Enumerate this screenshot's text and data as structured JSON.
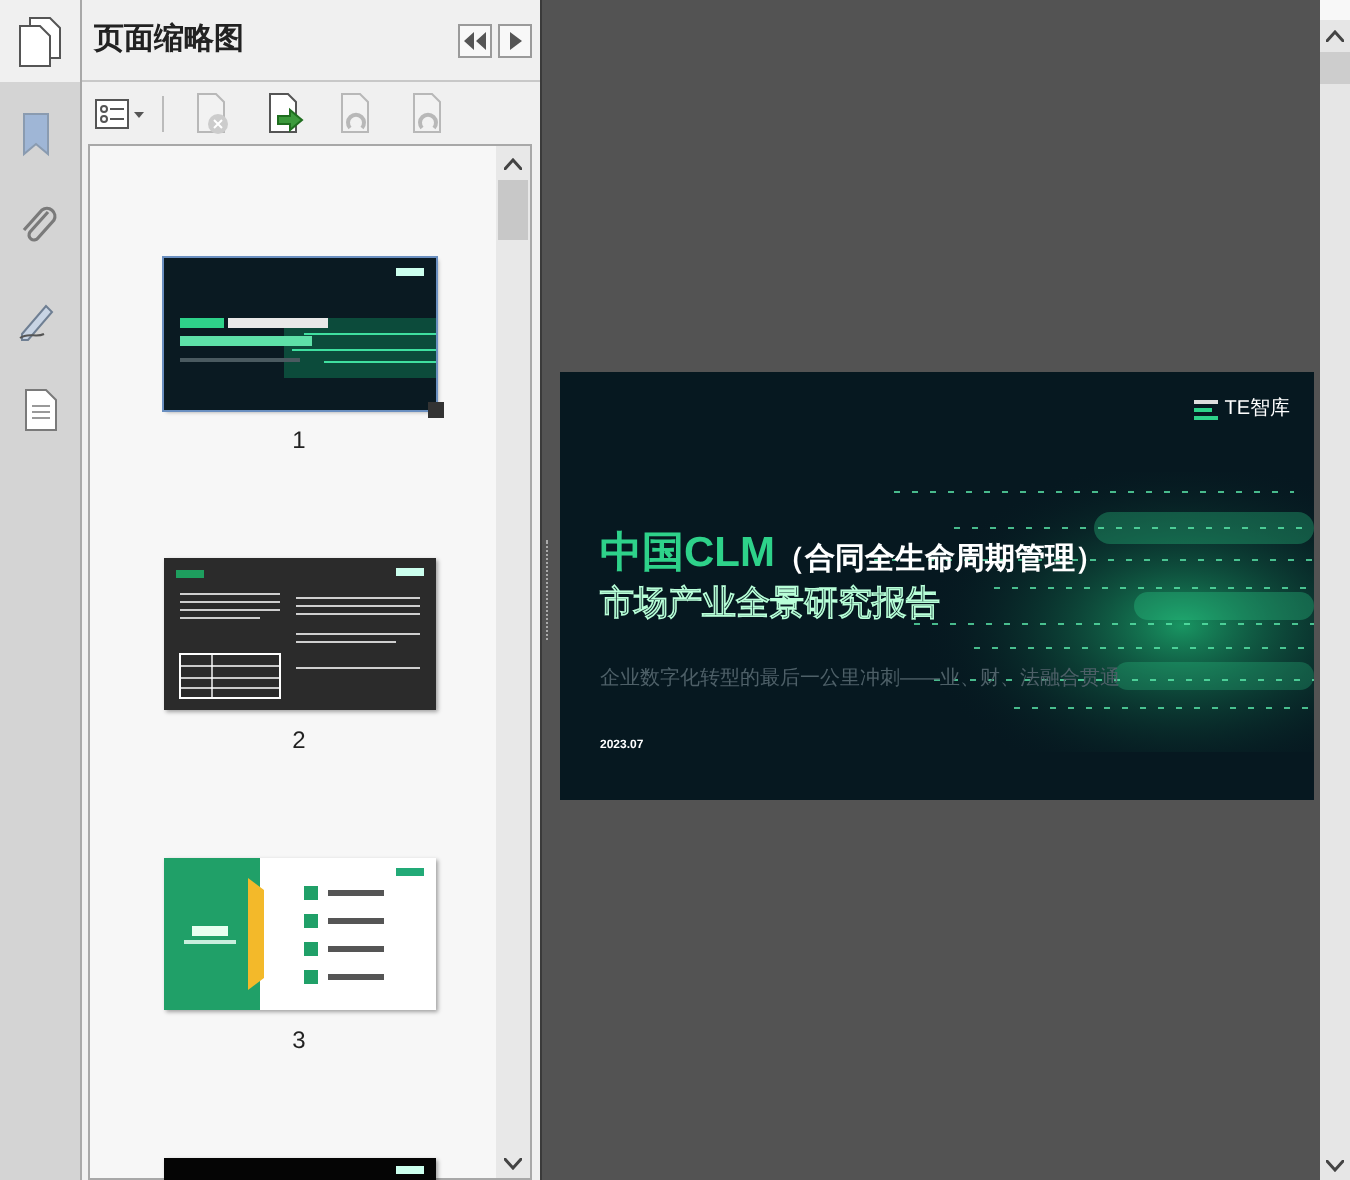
{
  "panel": {
    "title": "页面缩略图"
  },
  "rail": [
    {
      "kind": "bookmark",
      "selected": false
    },
    {
      "kind": "attachment",
      "selected": false
    },
    {
      "kind": "signature",
      "selected": false
    },
    {
      "kind": "document",
      "selected": false
    }
  ],
  "toolbar": [
    {
      "kind": "options",
      "disabled": false
    },
    {
      "kind": "delete",
      "disabled": true
    },
    {
      "kind": "extract",
      "disabled": false
    },
    {
      "kind": "rotate-left",
      "disabled": true
    },
    {
      "kind": "rotate-right",
      "disabled": true
    }
  ],
  "thumbnails": [
    {
      "kind": "cover",
      "page": "1",
      "selected": true
    },
    {
      "kind": "dark",
      "page": "2",
      "selected": false
    },
    {
      "kind": "contents",
      "page": "3",
      "selected": false
    },
    {
      "kind": "partial",
      "selected": false
    }
  ],
  "slide": {
    "logo": "TE智库",
    "title_a": "中国CLM",
    "title_b": "（合同全生命周期管理）",
    "title_c": "市场产业全景研究报告",
    "subtitle": "企业数字化转型的最后一公里冲刺——业、财、法融合贯通",
    "date": "2023.07"
  }
}
